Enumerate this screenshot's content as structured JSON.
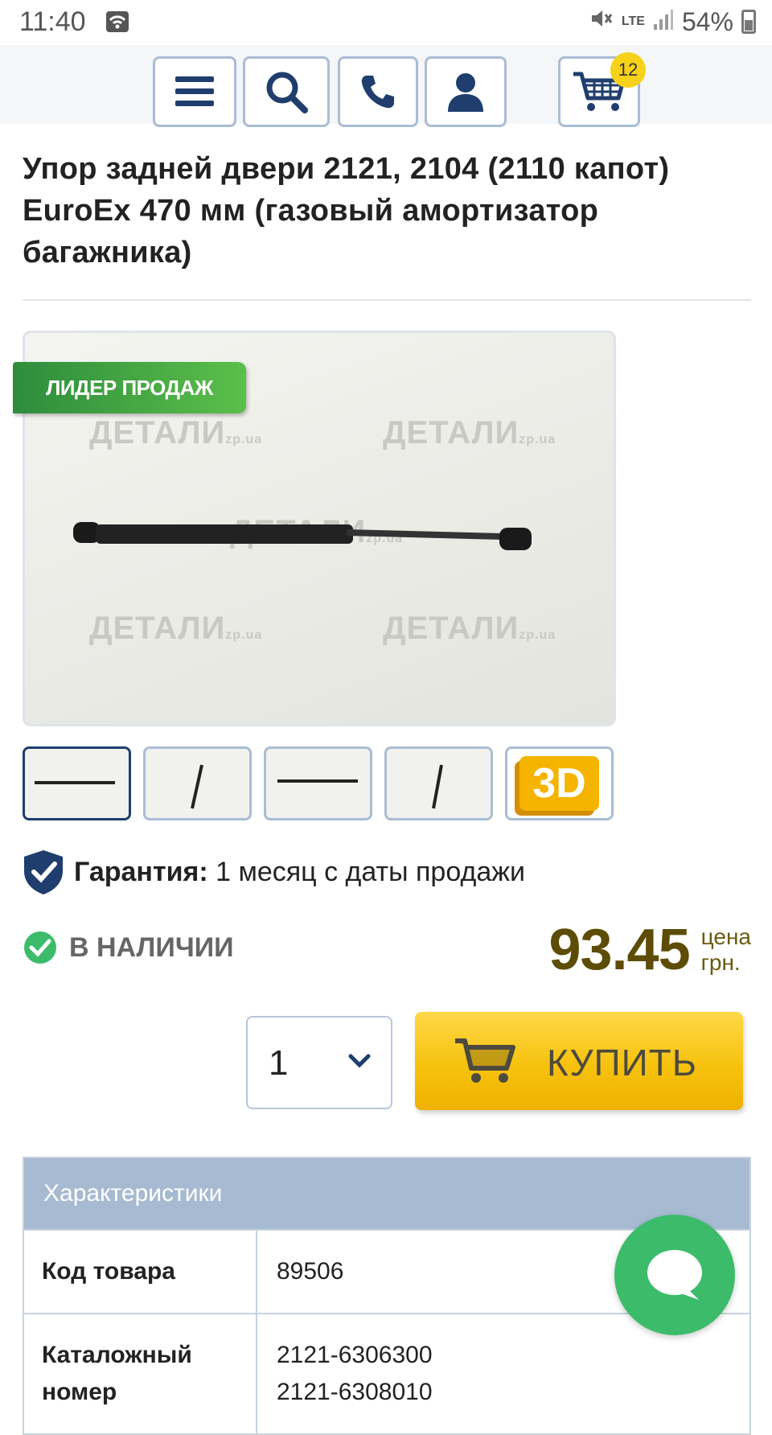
{
  "status_bar": {
    "time": "11:40",
    "battery": "54%",
    "network": "LTE"
  },
  "header": {
    "cart_count": "12"
  },
  "product": {
    "title": "Упор задней двери 2121, 2104 (2110 капот) EuroEx 470 мм (газовый амортизатор багажника)",
    "badge": "ЛИДЕР ПРОДАЖ",
    "watermark_brand": "ДЕТАЛИ",
    "watermark_domain": "zp.ua",
    "thumbnail_3d_label": "3D"
  },
  "guarantee": {
    "label": "Гарантия:",
    "value": "1 месяц с даты продажи"
  },
  "stock": {
    "label": "В НАЛИЧИИ"
  },
  "price": {
    "value": "93.45",
    "unit_line1": "цена",
    "unit_line2": "грн."
  },
  "purchase": {
    "quantity": "1",
    "buy_label": "КУПИТЬ"
  },
  "specs": {
    "header": "Характеристики",
    "rows": [
      {
        "key": "Код товара",
        "value": "89506"
      },
      {
        "key": "Каталожный номер",
        "value": "2121-6306300\n2121-6308010"
      }
    ]
  },
  "colors": {
    "accent": "#1f3e6e",
    "price": "#5c4c06",
    "buy": "#f6c20e",
    "stock": "#3cbc6b",
    "specs_header": "#a6bad2"
  }
}
